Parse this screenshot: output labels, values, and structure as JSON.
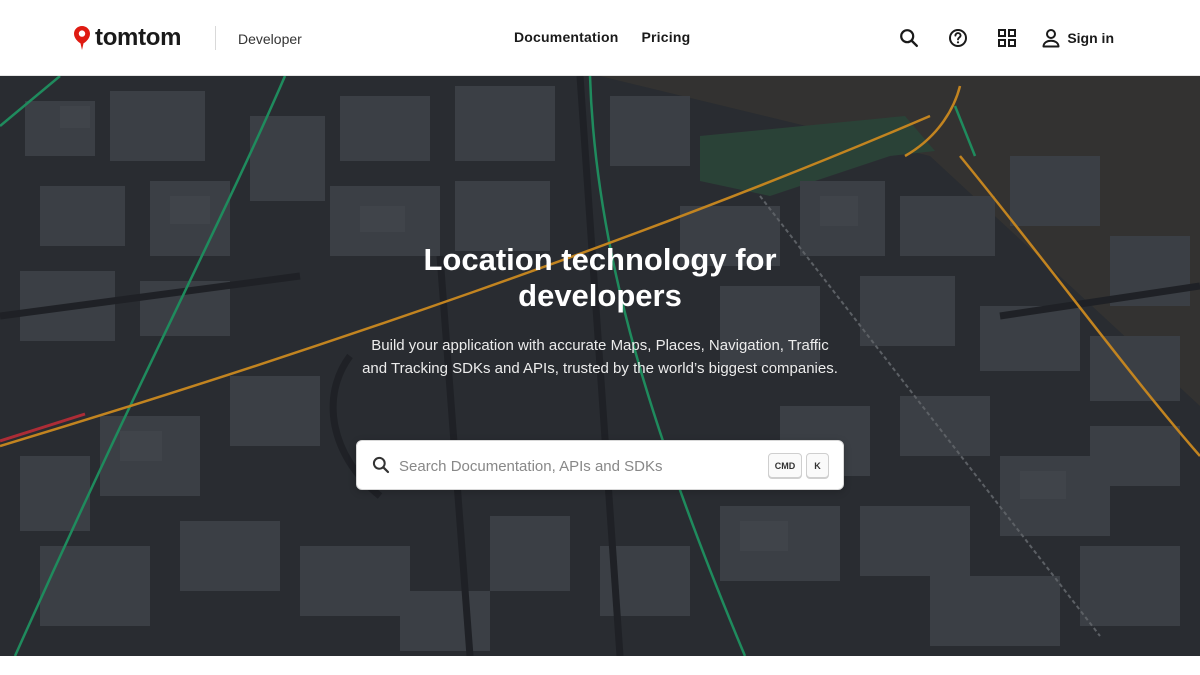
{
  "header": {
    "brand": "tomtom",
    "section": "Developer",
    "nav": [
      {
        "label": "Documentation"
      },
      {
        "label": "Pricing"
      }
    ],
    "sign_in": "Sign in"
  },
  "hero": {
    "title": "Location technology for developers",
    "description": "Build your application with accurate Maps, Places, Navigation, Traffic and Tracking SDKs and APIs, trusted by the world’s biggest companies."
  },
  "search": {
    "placeholder": "Search Documentation, APIs and SDKs",
    "shortcut_modifier": "CMD",
    "shortcut_key": "K"
  },
  "colors": {
    "brand_red": "#df1b12",
    "map_background": "#2a2e33",
    "road_green": "#1fa36a",
    "road_orange": "#e69a1f"
  }
}
